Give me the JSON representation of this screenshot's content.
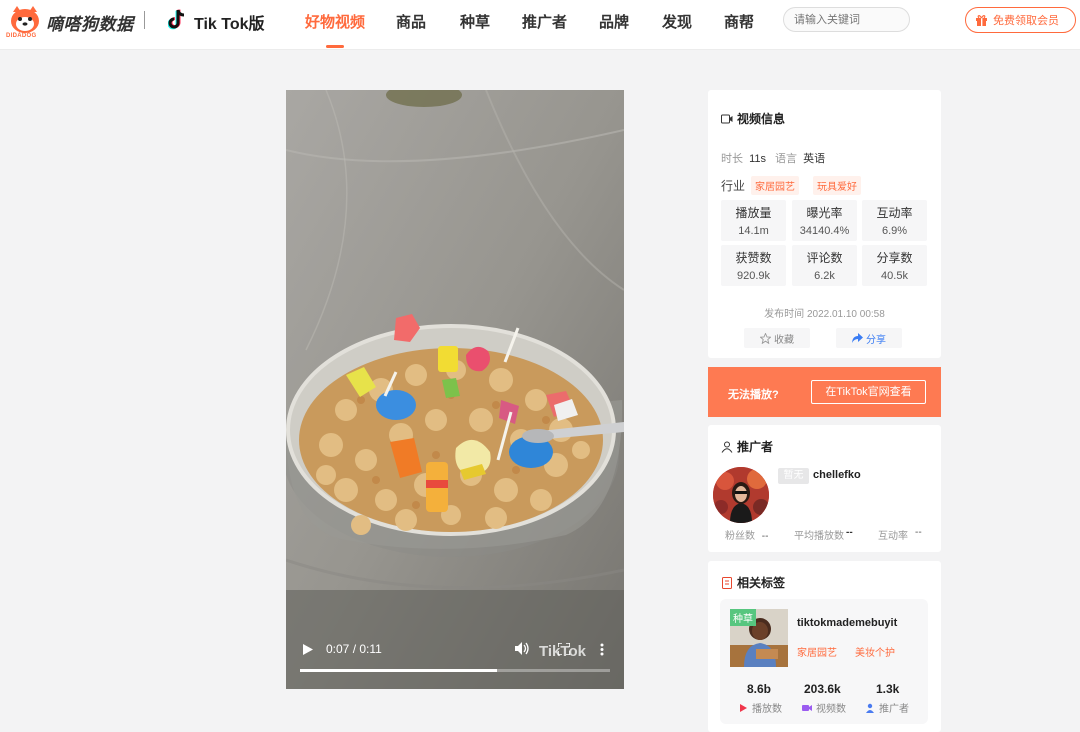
{
  "header": {
    "brand": "嘀嗒狗数据",
    "logo_text": "DIDADOG",
    "platform": "Tik Tok版",
    "nav": [
      "好物视频",
      "商品",
      "种草",
      "推广者",
      "品牌",
      "发现",
      "商帮"
    ],
    "active_nav": "好物视频",
    "search_placeholder": "请输入关键词",
    "vip_label": "免费领取会员"
  },
  "video": {
    "time": "0:07 / 0:11",
    "progress": 0.636,
    "watermark": "TikTok"
  },
  "info": {
    "title": "视频信息",
    "duration_label": "时长",
    "duration": "11s",
    "language_label": "语言",
    "language": "英语",
    "industry_label": "行业",
    "industry_tags": [
      "家居园艺",
      "玩具爱好"
    ],
    "stats": [
      {
        "label": "播放量",
        "value": "14.1m"
      },
      {
        "label": "曝光率",
        "value": "34140.4%"
      },
      {
        "label": "互动率",
        "value": "6.9%"
      },
      {
        "label": "获赞数",
        "value": "920.9k"
      },
      {
        "label": "评论数",
        "value": "6.2k"
      },
      {
        "label": "分享数",
        "value": "40.5k"
      }
    ],
    "publish_time": "发布时间 2022.01.10 00:58",
    "favorite_label": "收藏",
    "share_label": "分享"
  },
  "cta": {
    "question": "无法播放?",
    "button": "在TikTok官网查看"
  },
  "promoter": {
    "title": "推广者",
    "badge": "暂无",
    "name": "chellefko",
    "fans_label": "粉丝数",
    "fans": "--",
    "avg_label": "平均播放数",
    "avg": "--",
    "rate_label": "互动率",
    "rate": "--"
  },
  "tags": {
    "title": "相关标签",
    "badge": "种草",
    "name": "tiktokmademebuyit",
    "categories": [
      "家居园艺",
      "美妆个护"
    ],
    "stats": [
      {
        "value": "8.6b",
        "label": "播放数"
      },
      {
        "value": "203.6k",
        "label": "视频数"
      },
      {
        "value": "1.3k",
        "label": "推广者"
      }
    ]
  },
  "colors": {
    "accent": "#ff6a3d",
    "cta": "#fe7a52"
  }
}
